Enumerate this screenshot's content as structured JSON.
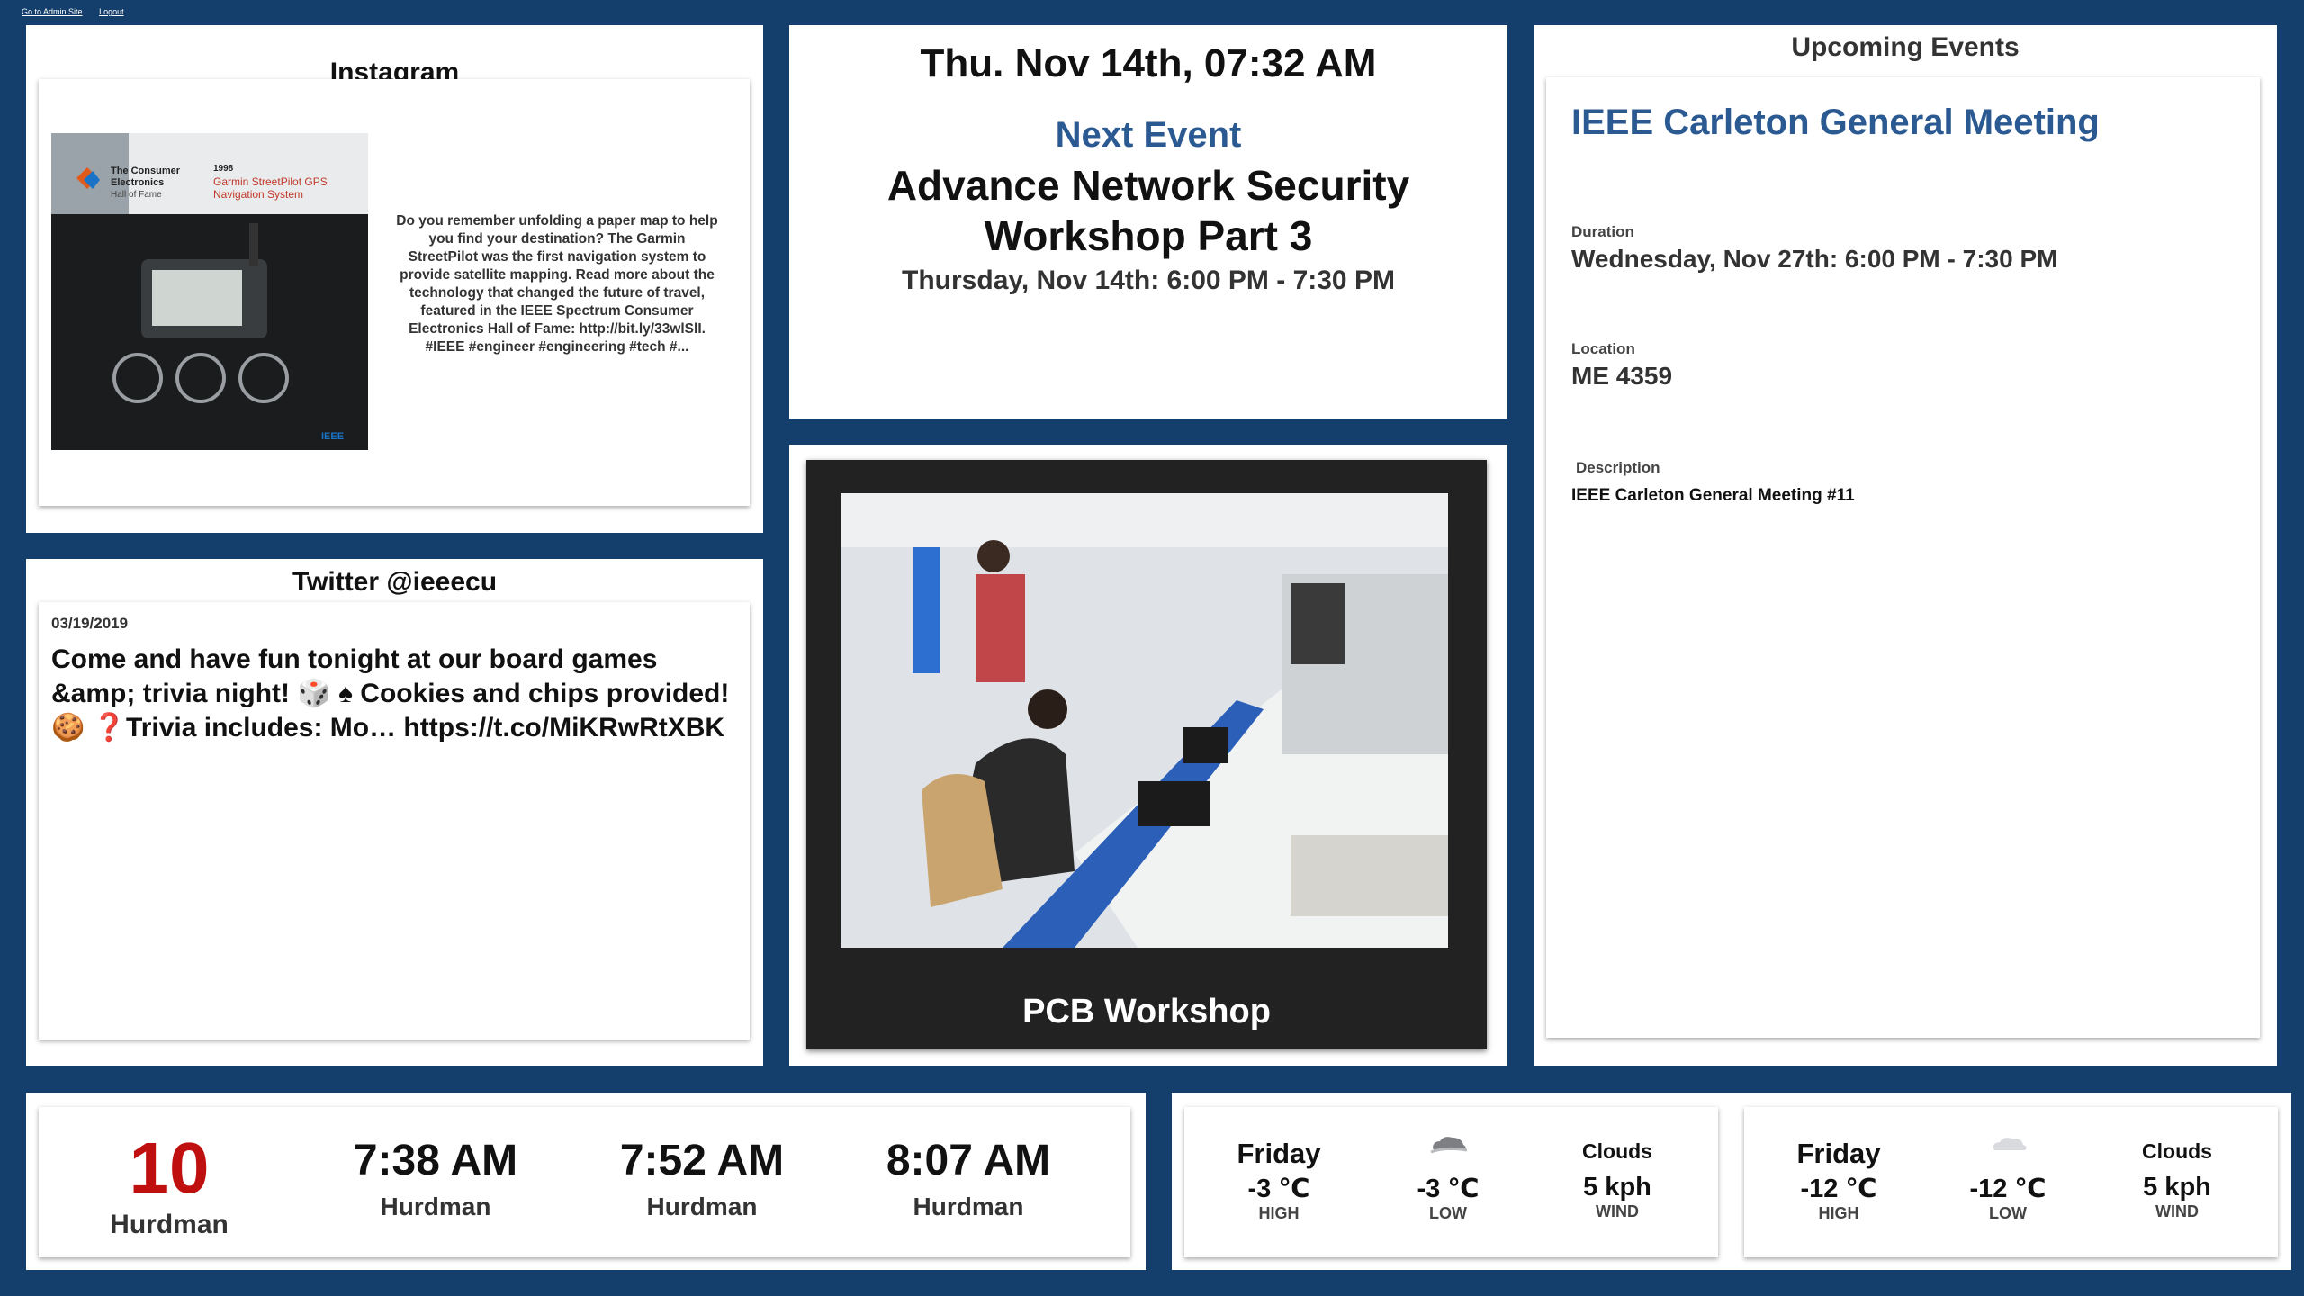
{
  "admin": {
    "go_admin": "Go to Admin Site",
    "logout": "Logout"
  },
  "instagram": {
    "title": "Instagram",
    "image": {
      "brand_line1": "The Consumer",
      "brand_line2": "Electronics",
      "brand_line3": "Hall of Fame",
      "year": "1998",
      "product_line1": "Garmin StreetPilot GPS",
      "product_line2": "Navigation System",
      "ieee_mark": "IEEE"
    },
    "caption": "Do you remember unfolding a paper map to help you find your destination? The Garmin StreetPilot was the first navigation system to provide satellite mapping. Read more about the technology that changed the future of travel, featured in the IEEE Spectrum Consumer Electronics Hall of Fame: http://bit.ly/33wlSlI. #IEEE #engineer #engineering #tech #..."
  },
  "twitter": {
    "title": "Twitter @ieeecu",
    "date": "03/19/2019",
    "text": "Come and have fun tonight at our board games &amp; trivia night! 🎲 ♠ Cookies and chips provided! 🍪 ❓Trivia includes: Mo… https://t.co/MiKRwRtXBK"
  },
  "next_event": {
    "clock": "Thu. Nov 14th, 07:32 AM",
    "label": "Next Event",
    "title": "Advance Network Security Workshop Part 3",
    "time": "Thursday, Nov 14th: 6:00 PM - 7:30 PM"
  },
  "slideshow": {
    "caption": "PCB Workshop"
  },
  "upcoming": {
    "title": "Upcoming Events",
    "event_title": "IEEE Carleton General Meeting",
    "duration_label": "Duration",
    "duration_value": "Wednesday, Nov 27th: 6:00 PM - 7:30 PM",
    "location_label": "Location",
    "location_value": "ME 4359",
    "description_label": "Description",
    "description_value": "IEEE Carleton General Meeting #11"
  },
  "bus": {
    "route": "10",
    "route_stop": "Hurdman",
    "times": [
      {
        "time": "7:38 AM",
        "stop": "Hurdman"
      },
      {
        "time": "7:52 AM",
        "stop": "Hurdman"
      },
      {
        "time": "8:07 AM",
        "stop": "Hurdman"
      }
    ]
  },
  "weather": [
    {
      "day": "Friday",
      "high": "-3 ℃",
      "high_label": "HIGH",
      "low": "-3 ℃",
      "low_label": "LOW",
      "condition": "Clouds",
      "wind": "5 kph",
      "wind_label": "WIND",
      "icon": "snow-cloud-icon"
    },
    {
      "day": "Friday",
      "high": "-12 ℃",
      "high_label": "HIGH",
      "low": "-12 ℃",
      "low_label": "LOW",
      "condition": "Clouds",
      "wind": "5 kph",
      "wind_label": "WIND",
      "icon": "cloud-icon"
    }
  ],
  "colors": {
    "background": "#143e6c",
    "accent_blue": "#2b5a92",
    "route_red": "#c00f0f"
  }
}
